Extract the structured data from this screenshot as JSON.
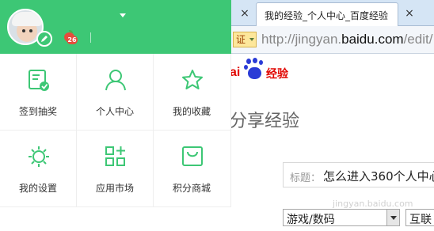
{
  "browser": {
    "tab_close_left": "×",
    "active_tab_title": "我的经验_个人中心_百度经验",
    "tab_close": "×",
    "cert_label": "证",
    "url_prefix": "http://jingyan.",
    "url_domain": "baidu.com",
    "url_suffix": "/edit/"
  },
  "site": {
    "logo_prefix": "ai",
    "logo_mark": "经验",
    "heading": "分享经验",
    "title_label": "标题：",
    "title_value": "怎么进入360个人中心",
    "category_value": "游戏/数码",
    "category2_value": "互联",
    "watermark": "jingyan.baidu.com"
  },
  "panel": {
    "level": "26",
    "accent": "#3dc775",
    "menu": [
      {
        "label": "签到抽奖",
        "icon": "checkin-icon"
      },
      {
        "label": "个人中心",
        "icon": "person-icon"
      },
      {
        "label": "我的收藏",
        "icon": "star-icon"
      },
      {
        "label": "我的设置",
        "icon": "settings-icon"
      },
      {
        "label": "应用市场",
        "icon": "apps-icon"
      },
      {
        "label": "积分商城",
        "icon": "shopping-bag-icon"
      }
    ]
  }
}
